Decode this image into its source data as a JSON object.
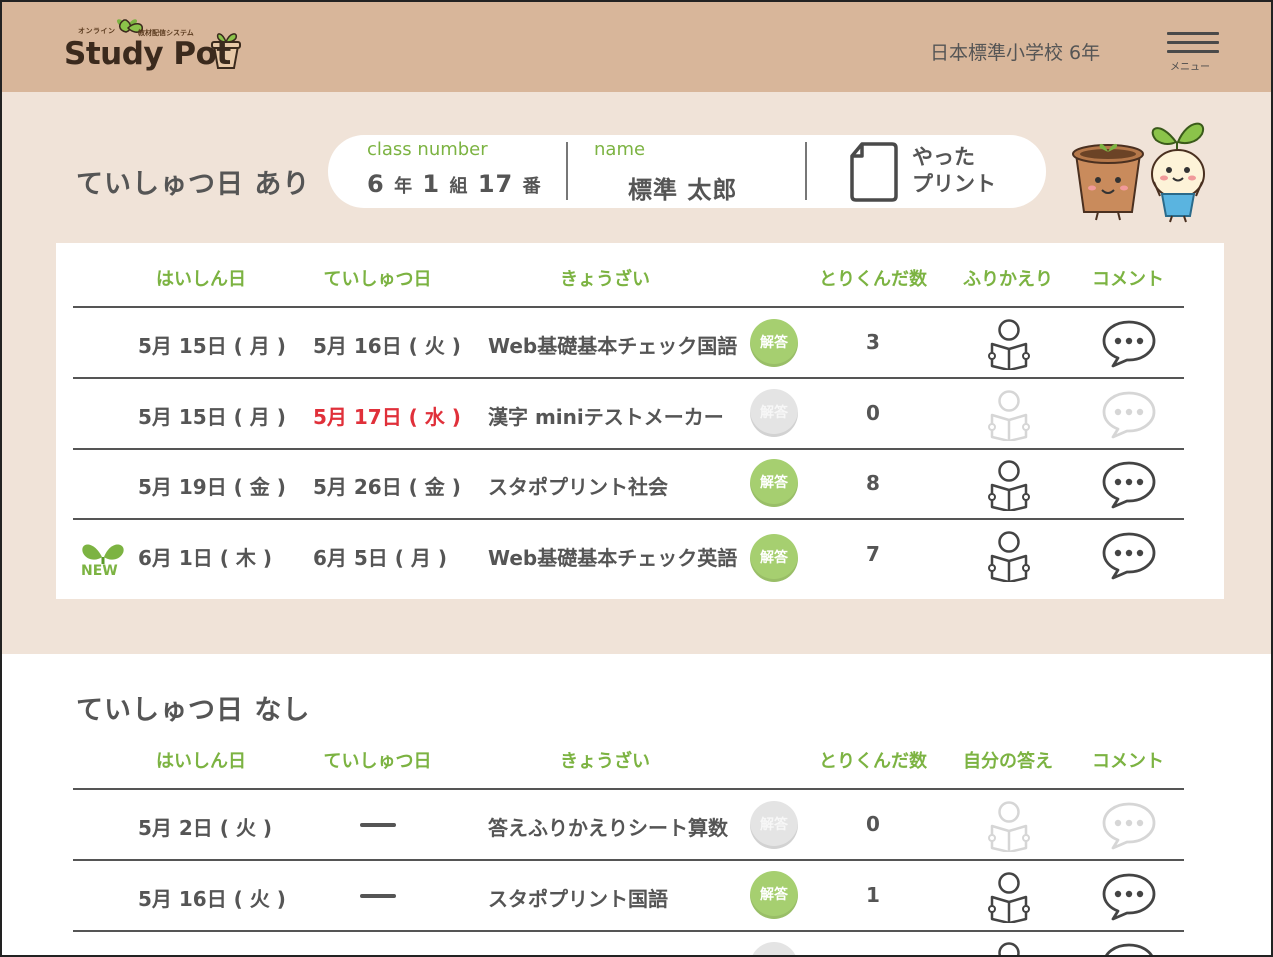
{
  "header": {
    "logo": {
      "text": "Study Pot",
      "sub_left": "オンライン",
      "sub_right": "教材配信システム"
    },
    "school": "日本標準小学校 6年",
    "menu_label": "メニュー"
  },
  "colors": {
    "header_bg": "#d8b69a",
    "section_bg": "#f0e3d8",
    "accent_green": "#7cb342",
    "badge_green": "#a6cf70",
    "deadline_red": "#e0303a"
  },
  "with_deadline": {
    "title": "ていしゅつ日 あり",
    "info": {
      "class_label": "class number",
      "grade": "6",
      "grade_unit": "年",
      "class": "1",
      "class_unit": "組",
      "number": "17",
      "number_unit": "番",
      "name_label": "name",
      "name": "標準 太郎",
      "print_line1": "やった",
      "print_line2": "プリント",
      "print_icon": "document-icon"
    },
    "columns": [
      "はいしん日",
      "ていしゅつ日",
      "きょうざい",
      "とりくんだ数",
      "ふりかえり",
      "コメント"
    ],
    "rows": [
      {
        "date": "5月 15日 ( 月 )",
        "due": "5月 16日 ( 火 )",
        "material": "Web基礎基本チェック国語",
        "answer": "解答",
        "count": "3",
        "new": false
      },
      {
        "date": "5月 15日 ( 月 )",
        "due": "5月 17日 ( 水 )",
        "material": "漢字 miniテストメーカー",
        "answer": "解答",
        "count": "0",
        "new": false
      },
      {
        "date": "5月 19日 ( 金 )",
        "due": "5月 26日 ( 金 )",
        "material": "スタポプリント社会",
        "answer": "解答",
        "count": "8",
        "new": false
      },
      {
        "date": "6月 1日 ( 木 )",
        "due": "6月 5日 ( 月 )",
        "material": "Web基礎基本チェック英語",
        "answer": "解答",
        "count": "7",
        "new": true,
        "new_label": "NEW"
      }
    ]
  },
  "without_deadline": {
    "title": "ていしゅつ日 なし",
    "columns": [
      "はいしん日",
      "ていしゅつ日",
      "きょうざい",
      "とりくんだ数",
      "自分の答え",
      "コメント"
    ],
    "rows": [
      {
        "date": "5月 2日 ( 火 )",
        "material": "答えふりかえりシート算数",
        "answer": "解答",
        "count": "0"
      },
      {
        "date": "5月 16日 ( 火 )",
        "material": "スタポプリント国語",
        "answer": "解答",
        "count": "1"
      }
    ]
  }
}
